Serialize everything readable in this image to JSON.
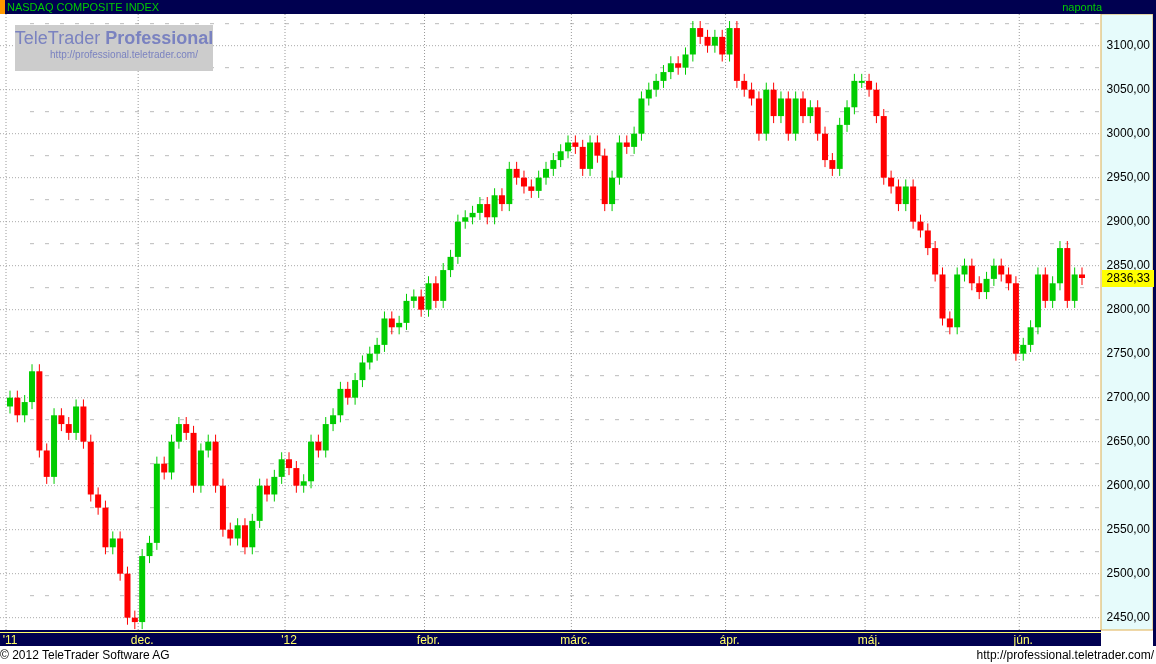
{
  "header": {
    "title": "NASDAQ COMPOSITE INDEX",
    "interval": "naponta"
  },
  "logo": {
    "name": "TeleTrader **Professional**",
    "url": "http://professional.teletrader.com/"
  },
  "chart": {
    "last_price": "2836,33",
    "chart_data": {
      "type": "candlestick",
      "grid": true,
      "ylim": [
        2436,
        3136
      ],
      "yticks": [
        {
          "value": 3100,
          "label": "3100,00"
        },
        {
          "value": 3050,
          "label": "3050,00"
        },
        {
          "value": 3000,
          "label": "3000,00"
        },
        {
          "value": 2950,
          "label": "2950,00"
        },
        {
          "value": 2900,
          "label": "2900,00"
        },
        {
          "value": 2850,
          "label": "2850,00"
        },
        {
          "value": 2800,
          "label": "2800,00"
        },
        {
          "value": 2750,
          "label": "2750,00"
        },
        {
          "value": 2700,
          "label": "2700,00"
        },
        {
          "value": 2650,
          "label": "2650,00"
        },
        {
          "value": 2600,
          "label": "2600,00"
        },
        {
          "value": 2550,
          "label": "2550,00"
        },
        {
          "value": 2500,
          "label": "2500,00"
        },
        {
          "value": 2450,
          "label": "2450,00"
        }
      ],
      "categories": [
        "'11",
        null,
        null,
        null,
        null,
        null,
        null,
        null,
        null,
        null,
        null,
        null,
        null,
        null,
        null,
        null,
        null,
        null,
        "dec.",
        null,
        null,
        null,
        null,
        null,
        null,
        null,
        null,
        null,
        null,
        null,
        null,
        null,
        null,
        null,
        null,
        null,
        null,
        null,
        "'12",
        null,
        null,
        null,
        null,
        null,
        null,
        null,
        null,
        null,
        null,
        null,
        null,
        null,
        null,
        null,
        null,
        null,
        null,
        "febr.",
        null,
        null,
        null,
        null,
        null,
        null,
        null,
        null,
        null,
        null,
        null,
        null,
        null,
        null,
        null,
        null,
        null,
        null,
        null,
        "márc.",
        null,
        null,
        null,
        null,
        null,
        null,
        null,
        null,
        null,
        null,
        null,
        null,
        null,
        null,
        null,
        null,
        null,
        null,
        null,
        null,
        "ápr.",
        null,
        null,
        null,
        null,
        null,
        null,
        null,
        null,
        null,
        null,
        null,
        null,
        null,
        null,
        null,
        null,
        null,
        null,
        "máj.",
        null,
        null,
        null,
        null,
        null,
        null,
        null,
        null,
        null,
        null,
        null,
        null,
        null,
        null,
        null,
        null,
        null,
        null,
        null,
        null,
        "jún.",
        null,
        null,
        null,
        null,
        null,
        null,
        null,
        null
      ],
      "ohlc": [
        [
          2690,
          2708,
          2682,
          2700
        ],
        [
          2700,
          2708,
          2672,
          2680
        ],
        [
          2680,
          2703,
          2672,
          2695
        ],
        [
          2695,
          2738,
          2687,
          2730
        ],
        [
          2730,
          2738,
          2632,
          2640
        ],
        [
          2640,
          2648,
          2602,
          2610
        ],
        [
          2610,
          2688,
          2602,
          2680
        ],
        [
          2680,
          2688,
          2662,
          2670
        ],
        [
          2670,
          2678,
          2652,
          2660
        ],
        [
          2660,
          2698,
          2652,
          2690
        ],
        [
          2690,
          2698,
          2642,
          2650
        ],
        [
          2650,
          2658,
          2582,
          2590
        ],
        [
          2590,
          2598,
          2567,
          2575
        ],
        [
          2575,
          2583,
          2522,
          2530
        ],
        [
          2530,
          2548,
          2522,
          2540
        ],
        [
          2540,
          2548,
          2492,
          2500
        ],
        [
          2500,
          2508,
          2442,
          2450
        ],
        [
          2450,
          2458,
          2437,
          2445
        ],
        [
          2445,
          2528,
          2437,
          2520
        ],
        [
          2520,
          2543,
          2512,
          2535
        ],
        [
          2535,
          2633,
          2527,
          2625
        ],
        [
          2625,
          2633,
          2607,
          2615
        ],
        [
          2615,
          2658,
          2607,
          2650
        ],
        [
          2650,
          2678,
          2642,
          2670
        ],
        [
          2670,
          2678,
          2652,
          2660
        ],
        [
          2660,
          2668,
          2592,
          2600
        ],
        [
          2600,
          2648,
          2592,
          2640
        ],
        [
          2640,
          2658,
          2632,
          2650
        ],
        [
          2650,
          2658,
          2592,
          2600
        ],
        [
          2600,
          2608,
          2542,
          2550
        ],
        [
          2550,
          2558,
          2532,
          2540
        ],
        [
          2540,
          2563,
          2532,
          2555
        ],
        [
          2555,
          2563,
          2522,
          2530
        ],
        [
          2530,
          2568,
          2522,
          2560
        ],
        [
          2560,
          2608,
          2552,
          2600
        ],
        [
          2600,
          2608,
          2582,
          2590
        ],
        [
          2590,
          2618,
          2582,
          2610
        ],
        [
          2610,
          2638,
          2602,
          2630
        ],
        [
          2630,
          2638,
          2612,
          2620
        ],
        [
          2620,
          2628,
          2592,
          2600
        ],
        [
          2600,
          2613,
          2592,
          2605
        ],
        [
          2605,
          2658,
          2597,
          2650
        ],
        [
          2650,
          2658,
          2632,
          2640
        ],
        [
          2640,
          2678,
          2632,
          2670
        ],
        [
          2670,
          2688,
          2662,
          2680
        ],
        [
          2680,
          2718,
          2672,
          2710
        ],
        [
          2710,
          2718,
          2692,
          2700
        ],
        [
          2700,
          2728,
          2692,
          2720
        ],
        [
          2720,
          2748,
          2712,
          2740
        ],
        [
          2740,
          2758,
          2732,
          2750
        ],
        [
          2750,
          2768,
          2742,
          2760
        ],
        [
          2760,
          2798,
          2752,
          2790
        ],
        [
          2790,
          2798,
          2772,
          2780
        ],
        [
          2780,
          2793,
          2772,
          2785
        ],
        [
          2785,
          2818,
          2777,
          2810
        ],
        [
          2810,
          2823,
          2802,
          2815
        ],
        [
          2815,
          2823,
          2792,
          2800
        ],
        [
          2800,
          2838,
          2792,
          2830
        ],
        [
          2830,
          2838,
          2802,
          2810
        ],
        [
          2810,
          2853,
          2802,
          2845
        ],
        [
          2845,
          2868,
          2837,
          2860
        ],
        [
          2860,
          2908,
          2852,
          2900
        ],
        [
          2900,
          2913,
          2892,
          2905
        ],
        [
          2905,
          2918,
          2897,
          2910
        ],
        [
          2910,
          2928,
          2902,
          2920
        ],
        [
          2920,
          2928,
          2897,
          2905
        ],
        [
          2905,
          2938,
          2897,
          2930
        ],
        [
          2930,
          2938,
          2912,
          2920
        ],
        [
          2920,
          2968,
          2912,
          2960
        ],
        [
          2960,
          2968,
          2942,
          2950
        ],
        [
          2950,
          2958,
          2932,
          2940
        ],
        [
          2940,
          2948,
          2927,
          2935
        ],
        [
          2935,
          2958,
          2927,
          2950
        ],
        [
          2950,
          2968,
          2942,
          2960
        ],
        [
          2960,
          2978,
          2952,
          2970
        ],
        [
          2970,
          2988,
          2962,
          2980
        ],
        [
          2980,
          2998,
          2972,
          2990
        ],
        [
          2990,
          2998,
          2977,
          2985
        ],
        [
          2985,
          2993,
          2952,
          2960
        ],
        [
          2960,
          2998,
          2952,
          2990
        ],
        [
          2990,
          2998,
          2967,
          2975
        ],
        [
          2975,
          2983,
          2912,
          2920
        ],
        [
          2920,
          2958,
          2912,
          2950
        ],
        [
          2950,
          2998,
          2942,
          2990
        ],
        [
          2990,
          2998,
          2977,
          2985
        ],
        [
          2985,
          3008,
          2977,
          3000
        ],
        [
          3000,
          3048,
          2992,
          3040
        ],
        [
          3040,
          3058,
          3032,
          3050
        ],
        [
          3050,
          3068,
          3042,
          3060
        ],
        [
          3060,
          3078,
          3052,
          3070
        ],
        [
          3070,
          3088,
          3062,
          3080
        ],
        [
          3080,
          3088,
          3067,
          3075
        ],
        [
          3075,
          3098,
          3067,
          3090
        ],
        [
          3090,
          3128,
          3082,
          3120
        ],
        [
          3120,
          3128,
          3102,
          3110
        ],
        [
          3110,
          3118,
          3092,
          3100
        ],
        [
          3100,
          3118,
          3092,
          3110
        ],
        [
          3110,
          3118,
          3082,
          3090
        ],
        [
          3090,
          3128,
          3082,
          3120
        ],
        [
          3120,
          3128,
          3052,
          3060
        ],
        [
          3060,
          3068,
          3042,
          3050
        ],
        [
          3050,
          3058,
          3032,
          3040
        ],
        [
          3040,
          3048,
          2992,
          3000
        ],
        [
          3000,
          3058,
          2992,
          3050
        ],
        [
          3050,
          3058,
          3012,
          3020
        ],
        [
          3020,
          3048,
          3012,
          3040
        ],
        [
          3040,
          3048,
          2992,
          3000
        ],
        [
          3000,
          3048,
          2992,
          3040
        ],
        [
          3040,
          3048,
          3012,
          3020
        ],
        [
          3020,
          3038,
          3012,
          3030
        ],
        [
          3030,
          3038,
          2992,
          3000
        ],
        [
          3000,
          3008,
          2962,
          2970
        ],
        [
          2970,
          2978,
          2952,
          2960
        ],
        [
          2960,
          3018,
          2952,
          3010
        ],
        [
          3010,
          3038,
          3002,
          3030
        ],
        [
          3030,
          3068,
          3022,
          3060
        ],
        [
          3060,
          3068,
          3052,
          3060
        ],
        [
          3060,
          3068,
          3042,
          3050
        ],
        [
          3050,
          3058,
          3012,
          3020
        ],
        [
          3020,
          3028,
          2942,
          2950
        ],
        [
          2950,
          2958,
          2932,
          2940
        ],
        [
          2940,
          2948,
          2912,
          2920
        ],
        [
          2920,
          2948,
          2912,
          2940
        ],
        [
          2940,
          2948,
          2892,
          2900
        ],
        [
          2900,
          2908,
          2882,
          2890
        ],
        [
          2890,
          2898,
          2862,
          2870
        ],
        [
          2870,
          2878,
          2832,
          2840
        ],
        [
          2840,
          2848,
          2782,
          2790
        ],
        [
          2790,
          2798,
          2772,
          2780
        ],
        [
          2780,
          2848,
          2772,
          2840
        ],
        [
          2840,
          2858,
          2832,
          2850
        ],
        [
          2850,
          2858,
          2822,
          2830
        ],
        [
          2830,
          2838,
          2812,
          2820
        ],
        [
          2820,
          2843,
          2812,
          2835
        ],
        [
          2835,
          2858,
          2827,
          2850
        ],
        [
          2850,
          2858,
          2832,
          2840
        ],
        [
          2840,
          2848,
          2822,
          2830
        ],
        [
          2830,
          2838,
          2742,
          2750
        ],
        [
          2750,
          2768,
          2742,
          2760
        ],
        [
          2760,
          2788,
          2752,
          2780
        ],
        [
          2780,
          2848,
          2772,
          2840
        ],
        [
          2840,
          2848,
          2802,
          2810
        ],
        [
          2810,
          2838,
          2802,
          2830
        ],
        [
          2830,
          2878,
          2822,
          2870
        ],
        [
          2870,
          2878,
          2802,
          2810
        ],
        [
          2810,
          2848,
          2802,
          2840
        ],
        [
          2840,
          2848,
          2828,
          2836
        ]
      ]
    }
  },
  "footer": {
    "copyright": "© 2012 TeleTrader Software AG",
    "url": "http://professional.teletrader.com/"
  }
}
